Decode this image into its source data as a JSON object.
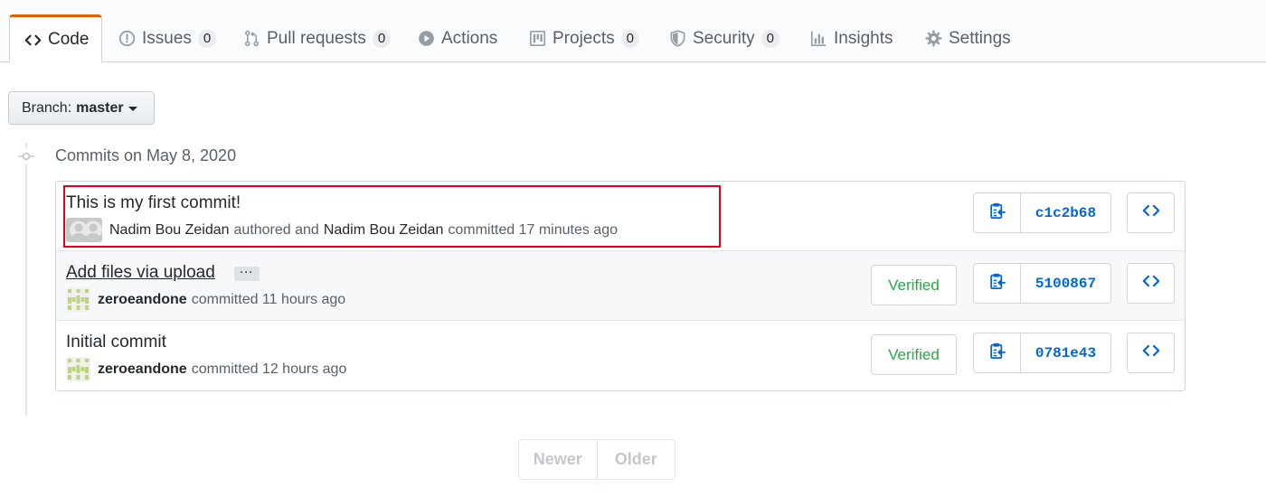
{
  "tabs": [
    {
      "label": "Code",
      "icon": "code-icon",
      "selected": true
    },
    {
      "label": "Issues",
      "icon": "issue-opened-icon",
      "count": "0"
    },
    {
      "label": "Pull requests",
      "icon": "git-pull-request-icon",
      "count": "0"
    },
    {
      "label": "Actions",
      "icon": "play-icon"
    },
    {
      "label": "Projects",
      "icon": "project-icon",
      "count": "0"
    },
    {
      "label": "Security",
      "icon": "shield-icon",
      "count": "0"
    },
    {
      "label": "Insights",
      "icon": "graph-icon"
    },
    {
      "label": "Settings",
      "icon": "gear-icon"
    }
  ],
  "branch": {
    "label": "Branch:",
    "value": "master"
  },
  "commit_group": {
    "heading": "Commits on May 8, 2020"
  },
  "commits": [
    {
      "title": "This is my first commit!",
      "author": "Nadim Bou Zeidan",
      "authored_text": "authored and",
      "committer": "Nadim Bou Zeidan",
      "committed_text": "committed 17 minutes ago",
      "sha": "c1c2b68",
      "verified": false
    },
    {
      "title": "Add files via upload",
      "ellipsis": "···",
      "committer": "zeroeandone",
      "committed_text": "committed 11 hours ago",
      "sha": "5100867",
      "verified": true,
      "verified_label": "Verified"
    },
    {
      "title": "Initial commit",
      "committer": "zeroeandone",
      "committed_text": "committed 12 hours ago",
      "sha": "0781e43",
      "verified": true,
      "verified_label": "Verified"
    }
  ],
  "pagination": {
    "newer": "Newer",
    "older": "Older"
  },
  "colors": {
    "tab_accent": "#e36209",
    "link_blue": "#0366d6",
    "verified_green": "#28a745",
    "highlight_red": "#e3001b"
  }
}
